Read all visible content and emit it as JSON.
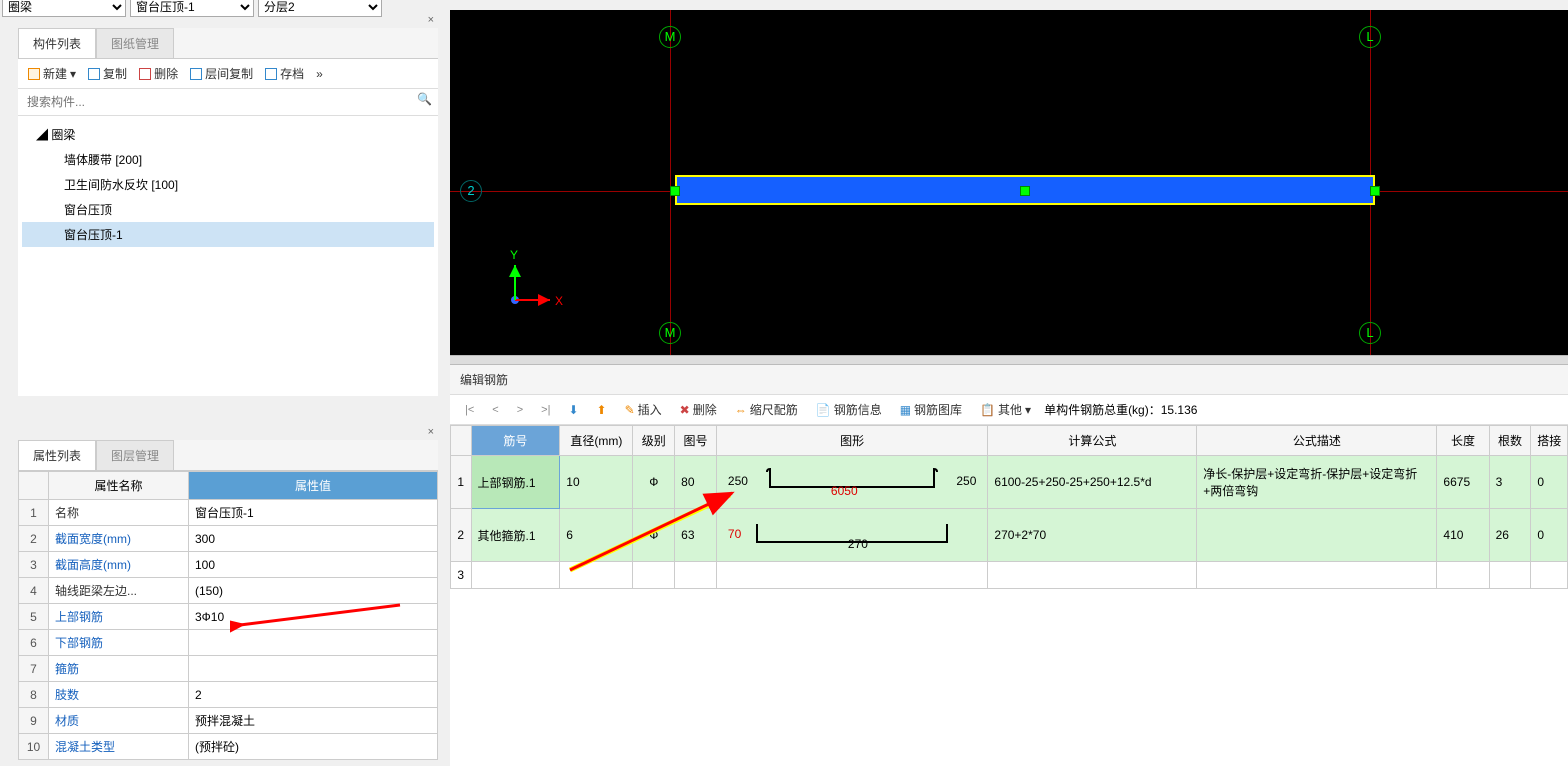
{
  "top_dropdowns": {
    "d1": "圈梁",
    "d2": "窗台压顶-1",
    "d3": "分层2"
  },
  "left_panel": {
    "tabs": [
      "构件列表",
      "图纸管理"
    ],
    "toolbar": {
      "new": "新建",
      "copy": "复制",
      "delete": "删除",
      "floor_copy": "层间复制",
      "archive": "存档"
    },
    "search_placeholder": "搜索构件...",
    "tree": {
      "root": "圈梁",
      "items": [
        "墙体腰带 [200]",
        "卫生间防水反坎 [100]",
        "窗台压顶",
        "窗台压顶-1"
      ],
      "selected_idx": 3
    }
  },
  "props_panel": {
    "tabs": [
      "属性列表",
      "图层管理"
    ],
    "headers": {
      "name": "属性名称",
      "value": "属性值"
    },
    "rows": [
      {
        "n": "1",
        "name": "名称",
        "value": "窗台压顶-1",
        "black": true
      },
      {
        "n": "2",
        "name": "截面宽度(mm)",
        "value": "300"
      },
      {
        "n": "3",
        "name": "截面高度(mm)",
        "value": "100"
      },
      {
        "n": "4",
        "name": "轴线距梁左边...",
        "value": "(150)",
        "black": true
      },
      {
        "n": "5",
        "name": "上部钢筋",
        "value": "3Ф10"
      },
      {
        "n": "6",
        "name": "下部钢筋",
        "value": ""
      },
      {
        "n": "7",
        "name": "箍筋",
        "value": ""
      },
      {
        "n": "8",
        "name": "肢数",
        "value": "2"
      },
      {
        "n": "9",
        "name": "材质",
        "value": "预拌混凝土"
      },
      {
        "n": "10",
        "name": "混凝土类型",
        "value": "(预拌砼)"
      }
    ]
  },
  "canvas": {
    "axis_top": [
      "M",
      "L"
    ],
    "axis_bot": [
      "M",
      "L"
    ],
    "row": "2",
    "coord_x": "X",
    "coord_y": "Y"
  },
  "rebar": {
    "title": "编辑钢筋",
    "nav": [
      "|<",
      "<",
      ">",
      ">|"
    ],
    "tools": {
      "insert": "插入",
      "delete": "删除",
      "scale": "缩尺配筋",
      "info": "钢筋信息",
      "gallery": "钢筋图库",
      "other": "其他"
    },
    "weight_label": "单构件钢筋总重(kg)：",
    "weight_value": "15.136",
    "headers": [
      "筋号",
      "直径(mm)",
      "级别",
      "图号",
      "图形",
      "计算公式",
      "公式描述",
      "长度",
      "根数",
      "搭接"
    ],
    "rows": [
      {
        "n": "1",
        "name": "上部钢筋.1",
        "dia": "10",
        "grade": "Ф",
        "code": "80",
        "shape": {
          "left": "250",
          "mid": "6050",
          "right": "250",
          "hooks": true
        },
        "formula": "6100-25+250-25+250+12.5*d",
        "desc": "净长-保护层+设定弯折-保护层+设定弯折+两倍弯钩",
        "len": "6675",
        "cnt": "3",
        "lap": "0"
      },
      {
        "n": "2",
        "name": "其他箍筋.1",
        "dia": "6",
        "grade": "Ф",
        "code": "63",
        "shape": {
          "left": "70",
          "mid": "270",
          "right": "",
          "hooks": false
        },
        "formula": "270+2*70",
        "desc": "",
        "len": "410",
        "cnt": "26",
        "lap": "0"
      }
    ]
  }
}
